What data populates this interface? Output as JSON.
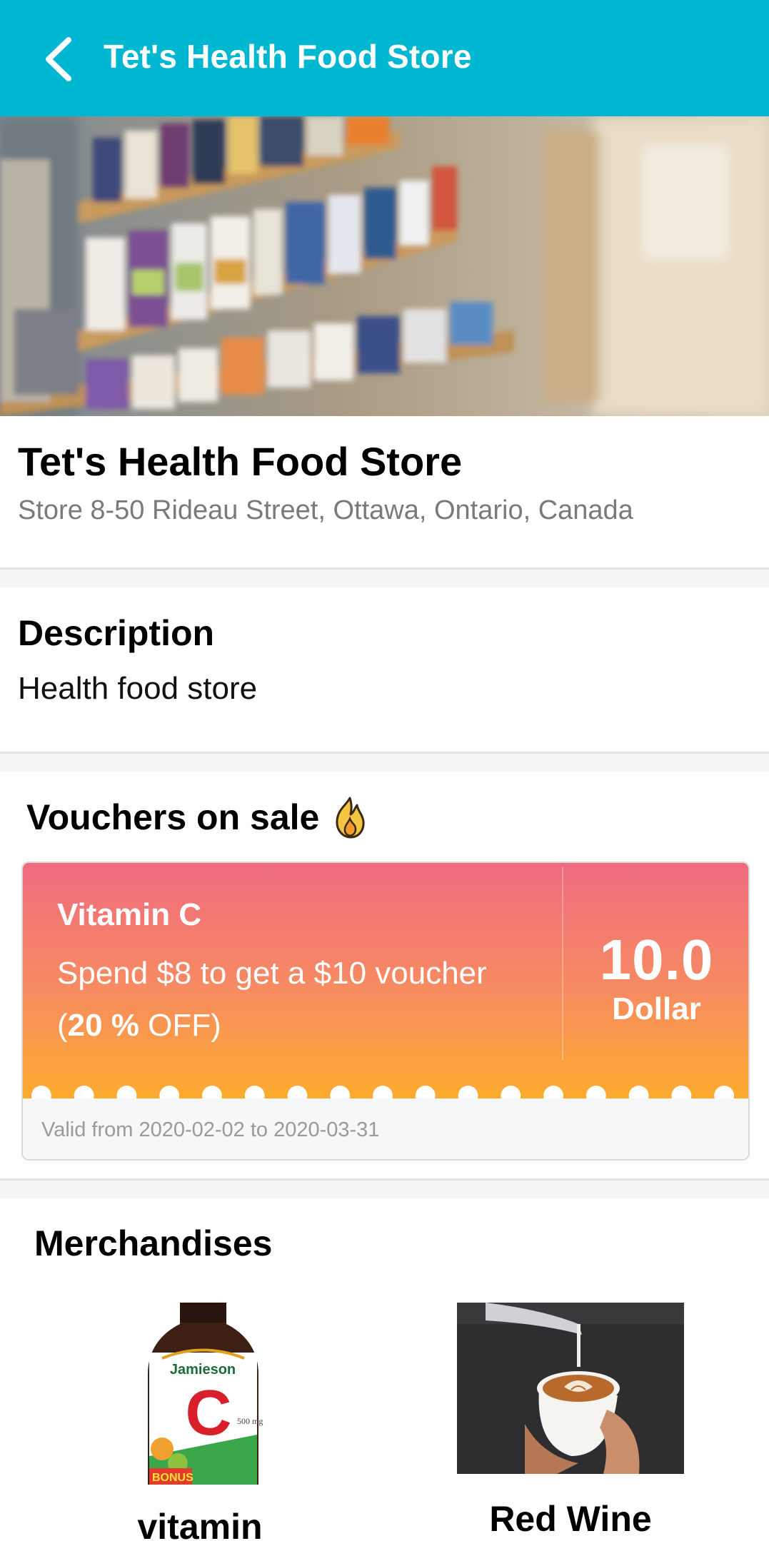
{
  "appbar": {
    "title": "Tet's Health Food Store",
    "back_icon": "chevron-left-icon",
    "background": "#00b7d1"
  },
  "hero": {
    "alt": "store-shelves-photo"
  },
  "store": {
    "name": "Tet's Health Food Store",
    "address": "Store 8-50 Rideau Street, Ottawa, Ontario, Canada"
  },
  "description": {
    "heading": "Description",
    "text": "Health food store"
  },
  "vouchers": {
    "heading": "Vouchers on sale",
    "heading_icon": "flame-icon",
    "items": [
      {
        "name": "Vitamin C",
        "offer": "Spend $8 to get a $10 voucher",
        "discount_open": "(",
        "discount": "20 %",
        "discount_close": " OFF)",
        "amount": "10.0",
        "unit": "Dollar",
        "validity": "Valid from 2020-02-02 to 2020-03-31",
        "gradient_top": "#ef6b80",
        "gradient_bottom": "#fdab2e"
      }
    ]
  },
  "merchandise": {
    "heading": "Merchandises",
    "items": [
      {
        "name": "vitamin",
        "image": "vitamin-bottle-image"
      },
      {
        "name": "Red Wine",
        "image": "latte-cup-image"
      }
    ]
  }
}
